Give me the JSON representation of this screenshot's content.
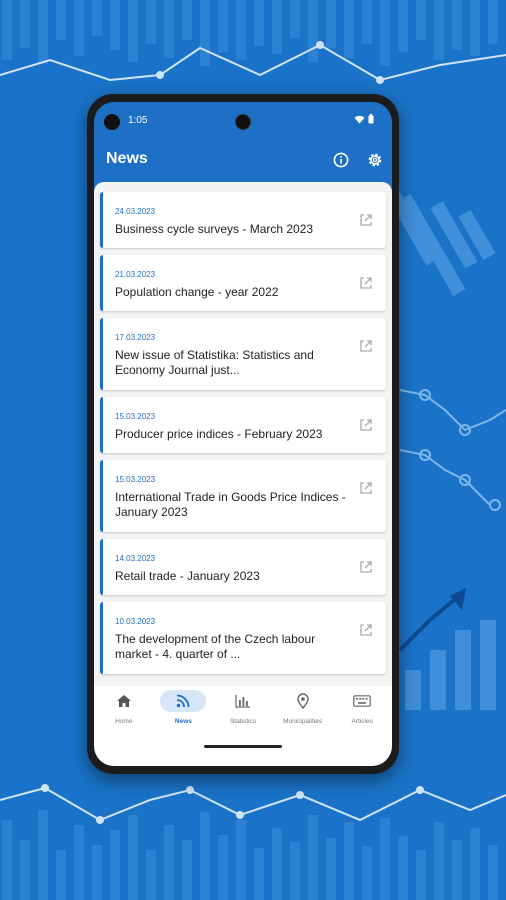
{
  "status_bar": {
    "time": "1:05"
  },
  "app_bar": {
    "title": "News"
  },
  "news": [
    {
      "date": "24.03.2023",
      "title": "Business cycle surveys - March 2023"
    },
    {
      "date": "21.03.2023",
      "title": "Population change - year 2022"
    },
    {
      "date": "17.03.2023",
      "title": "New issue of Statistika: Statistics and Economy Journal just..."
    },
    {
      "date": "15.03.2023",
      "title": "Producer price indices - February 2023"
    },
    {
      "date": "15.03.2023",
      "title": "International Trade in Goods Price Indices  - January 2023"
    },
    {
      "date": "14.03.2023",
      "title": "Retail trade - January 2023"
    },
    {
      "date": "10.03.2023",
      "title": "The development of the Czech labour market - 4. quarter of ..."
    }
  ],
  "nav": [
    {
      "label": "Home",
      "icon": "home-icon",
      "active": false
    },
    {
      "label": "News",
      "icon": "rss-icon",
      "active": true
    },
    {
      "label": "Statistics",
      "icon": "bar-chart-icon",
      "active": false
    },
    {
      "label": "Municipalities",
      "icon": "map-pin-icon",
      "active": false
    },
    {
      "label": "Articles",
      "icon": "keyboard-icon",
      "active": false
    }
  ],
  "colors": {
    "brand": "#1e6fc6",
    "background": "#1a73c8",
    "active_tab_bg": "#d6e6f8"
  }
}
